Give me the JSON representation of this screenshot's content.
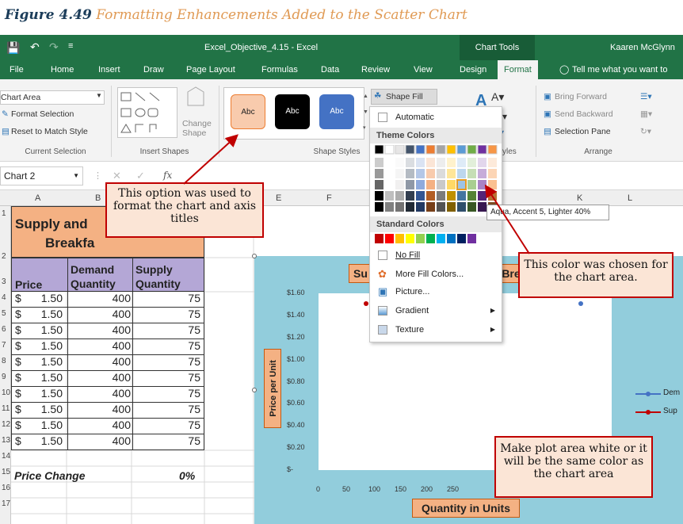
{
  "caption": {
    "figure": "Figure 4.49",
    "title": "Formatting Enhancements Added to the Scatter Chart"
  },
  "titlebar": {
    "filename": "Excel_Objective_4.15  -  Excel",
    "context": "Chart Tools",
    "user": "Kaaren McGlynn"
  },
  "menu": [
    "File",
    "Home",
    "Insert",
    "Draw",
    "Page Layout",
    "Formulas",
    "Data",
    "Review",
    "View",
    "Design",
    "Format"
  ],
  "tellme": "Tell me what you want to",
  "ribbon": {
    "selection_value": "Chart Area",
    "format_selection": "Format Selection",
    "reset_style": "Reset to Match Style",
    "group_current": "Current Selection",
    "group_insert_shapes": "Insert Shapes",
    "change_shape": "Change Shape",
    "group_shape_styles": "Shape Styles",
    "style_label": "Abc",
    "shape_fill": "Shape Fill",
    "wordart_label": "yles",
    "bring_forward": "Bring Forward",
    "send_backward": "Send Backward",
    "selection_pane": "Selection Pane",
    "group_arrange": "Arrange"
  },
  "namebox": "Chart 2",
  "fx": "fx",
  "columns": [
    "A",
    "B",
    "E",
    "F",
    "K",
    "L"
  ],
  "rows": [
    "1",
    "2",
    "3",
    "4",
    "5",
    "6",
    "7",
    "8",
    "9",
    "10",
    "11",
    "12",
    "13",
    "14",
    "15",
    "16",
    "17"
  ],
  "sheet": {
    "title_line1": "Supply and",
    "title_line2": "Breakfa",
    "hdr_price": "Price",
    "hdr_demand": "Demand Quantity",
    "hdr_demand1": "Demand",
    "hdr_demand2": "Quantity",
    "hdr_supply1": "Supply",
    "hdr_supply2": "Quantity",
    "data_rows": [
      {
        "cur": "$",
        "price": "1.50",
        "demand": "400",
        "supply": "75"
      },
      {
        "cur": "$",
        "price": "1.50",
        "demand": "400",
        "supply": "75"
      },
      {
        "cur": "$",
        "price": "1.50",
        "demand": "400",
        "supply": "75"
      },
      {
        "cur": "$",
        "price": "1.50",
        "demand": "400",
        "supply": "75"
      },
      {
        "cur": "$",
        "price": "1.50",
        "demand": "400",
        "supply": "75"
      },
      {
        "cur": "$",
        "price": "1.50",
        "demand": "400",
        "supply": "75"
      },
      {
        "cur": "$",
        "price": "1.50",
        "demand": "400",
        "supply": "75"
      },
      {
        "cur": "$",
        "price": "1.50",
        "demand": "400",
        "supply": "75"
      },
      {
        "cur": "$",
        "price": "1.50",
        "demand": "400",
        "supply": "75"
      },
      {
        "cur": "$",
        "price": "1.50",
        "demand": "400",
        "supply": "75"
      }
    ],
    "price_change_label": "Price Change",
    "price_change_value": "0%"
  },
  "dropdown": {
    "automatic": "Automatic",
    "theme_colors": "Theme Colors",
    "standard_colors": "Standard Colors",
    "no_fill": "No Fill",
    "more_fill": "More Fill Colors...",
    "picture": "Picture...",
    "gradient": "Gradient",
    "texture": "Texture",
    "tooltip": "Aqua, Accent 5, Lighter 40%",
    "theme_top": [
      "#000000",
      "#ffffff",
      "#e7e6e6",
      "#44546a",
      "#4472c4",
      "#ed7d31",
      "#a5a5a5",
      "#ffc000",
      "#5b9bd5",
      "#70ad47",
      "#7030a0",
      "#f79646"
    ],
    "standard": [
      "#c00000",
      "#ff0000",
      "#ffc000",
      "#ffff00",
      "#92d050",
      "#00b050",
      "#00b0f0",
      "#0070c0",
      "#002060",
      "#7030a0"
    ]
  },
  "chart": {
    "title_left": "Su",
    "title_right": "Bre",
    "y_title": "Price per Unit",
    "x_title": "Quantity in Units",
    "y_ticks": [
      "$1.60",
      "$1.40",
      "$1.20",
      "$1.00",
      "$0.80",
      "$0.60",
      "$0.40",
      "$0.20",
      "$-"
    ],
    "x_ticks": [
      "0",
      "50",
      "100",
      "150",
      "200",
      "250"
    ],
    "legend": [
      "Dem",
      "Sup"
    ],
    "area_color": "#92cddc",
    "plot_color": "#ffffff"
  },
  "callouts": {
    "titles": "This option was used to format the chart and axis titles",
    "chartarea": "This color was chosen for the chart area.",
    "plotarea": "Make plot area white or it will be the same color as the chart area"
  }
}
